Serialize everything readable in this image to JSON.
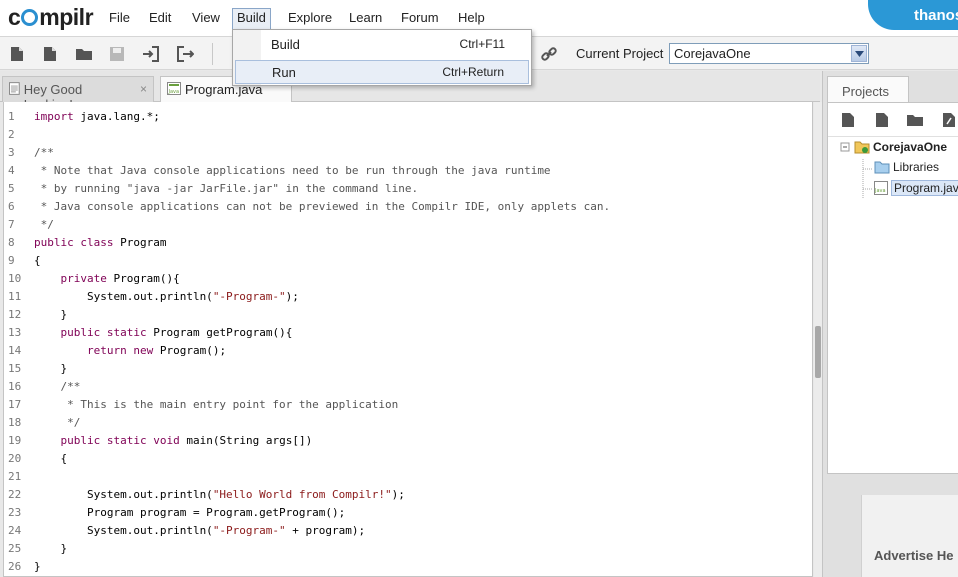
{
  "app": {
    "logo": "compilr",
    "user_name": "thanos"
  },
  "menu": {
    "items": [
      "File",
      "Edit",
      "View",
      "Build",
      "Explore",
      "Learn",
      "Forum",
      "Help"
    ],
    "active": "Build"
  },
  "build_menu": {
    "items": [
      {
        "label": "Build",
        "shortcut": "Ctrl+F11"
      },
      {
        "label": "Run",
        "shortcut": "Ctrl+Return"
      }
    ],
    "highlighted": "Run"
  },
  "toolbar": {
    "icons": [
      "new-file-icon",
      "new-document-icon",
      "open-folder-icon",
      "save-icon",
      "import-icon",
      "export-icon",
      "link-icon"
    ],
    "current_project_label": "Current Project",
    "current_project_value": "CorejavaOne"
  },
  "editor": {
    "tabs": [
      {
        "label": "Hey Good Looking!",
        "close": "×",
        "active": false
      },
      {
        "label": "Program.java",
        "active": true
      }
    ],
    "lines": [
      "import java.lang.*;",
      "",
      "/**",
      " * Note that Java console applications need to be run through the java runtime",
      " * by running \"java -jar JarFile.jar\" in the command line.",
      " * Java console applications can not be previewed in the Compilr IDE, only applets can.",
      " */",
      "public class Program",
      "{",
      "    private Program(){",
      "        System.out.println(\"-Program-\");",
      "    }",
      "    public static Program getProgram(){",
      "        return new Program();",
      "    }",
      "    /**",
      "     * This is the main entry point for the application",
      "     */",
      "    public static void main(String args[])",
      "    {",
      "",
      "        System.out.println(\"Hello World from Compilr!\");",
      "        Program program = Program.getProgram();",
      "        System.out.println(\"-Program-\" + program);",
      "    }",
      "}"
    ]
  },
  "projects": {
    "tab_label": "Projects",
    "tree": {
      "root": "CorejavaOne",
      "children": [
        "Libraries",
        "Program.java"
      ],
      "selected": "Program.java"
    },
    "ad_text": "Advertise He"
  },
  "colors": {
    "accent": "#2b98d6",
    "keyword": "#7f0055",
    "string": "#8b1a1a"
  }
}
